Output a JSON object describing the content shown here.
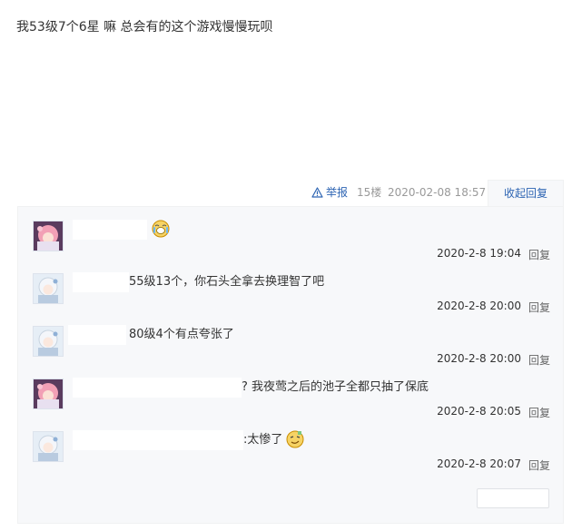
{
  "post": {
    "content": "我53级7个6星 嘛 总会有的这个游戏慢慢玩呗"
  },
  "meta": {
    "report_label": "举报",
    "floor": "15楼",
    "time": "2020-02-08 18:57",
    "collapse_label": "收起回复"
  },
  "replies": [
    {
      "avatar": "pink-hair-avatar",
      "text": "",
      "emoji": "crying-face-emoji",
      "time": "2020-2-8 19:04",
      "reply_label": "回复"
    },
    {
      "avatar": "white-hair-avatar",
      "text": "55级13个，你石头全拿去换理智了吧",
      "time": "2020-2-8 20:00",
      "reply_label": "回复"
    },
    {
      "avatar": "white-hair-avatar",
      "text": "80级4个有点夸张了",
      "time": "2020-2-8 20:00",
      "reply_label": "回复"
    },
    {
      "avatar": "pink-hair-avatar",
      "text": "? 我夜莺之后的池子全都只抽了保底",
      "time": "2020-2-8 20:05",
      "reply_label": "回复"
    },
    {
      "avatar": "white-hair-avatar",
      "text": ":太惨了",
      "emoji": "smug-face-emoji",
      "time": "2020-2-8 20:07",
      "reply_label": "回复"
    }
  ],
  "colors": {
    "link": "#2d64b3",
    "muted": "#999999",
    "panel_bg": "#f7f8fa"
  }
}
